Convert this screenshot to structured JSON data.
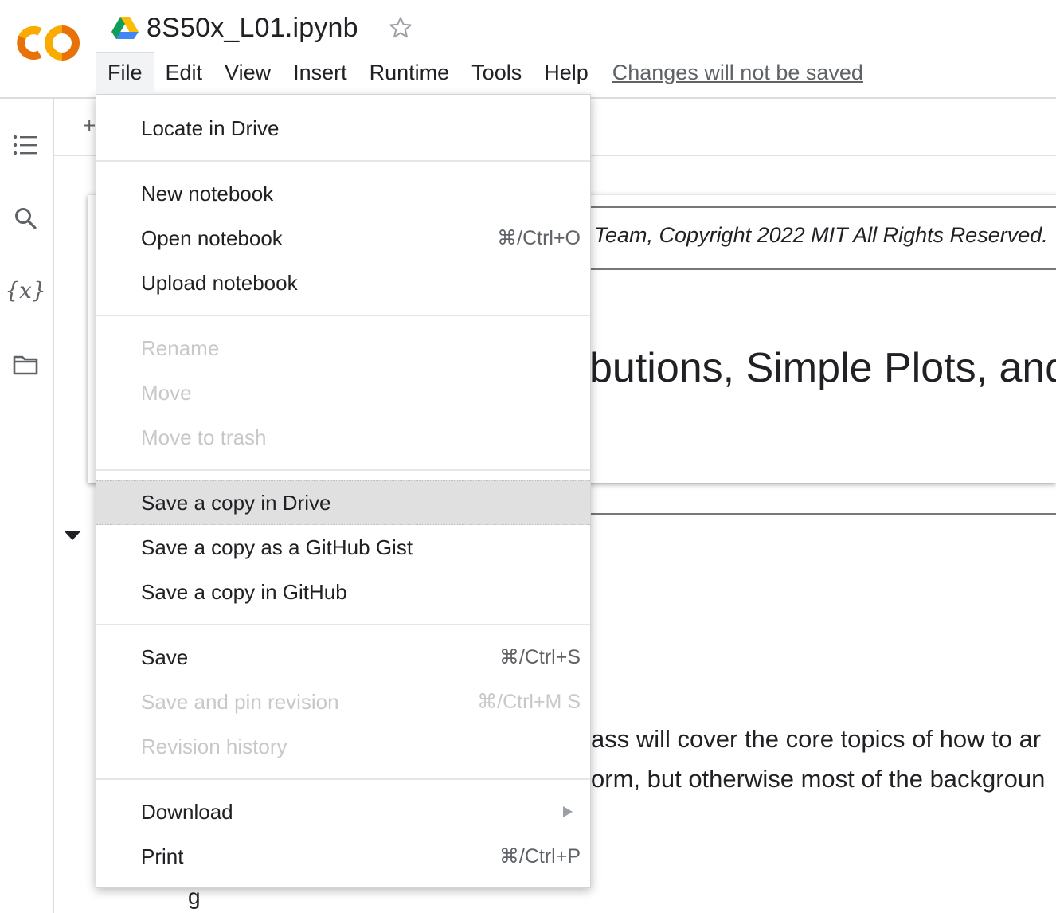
{
  "app": {
    "notebook_title": "8S50x_L01.ipynb",
    "colors": {
      "logo_orange": "#F9AB00",
      "logo_dark_orange": "#E8710A"
    }
  },
  "menubar": {
    "items": [
      "File",
      "Edit",
      "View",
      "Insert",
      "Runtime",
      "Tools",
      "Help"
    ],
    "active": "File",
    "changes_notice": "Changes will not be saved"
  },
  "rail": {
    "icons": [
      "table-of-contents-icon",
      "search-icon",
      "variables-icon",
      "files-folder-icon"
    ],
    "variables_glyph": "{x}"
  },
  "toolbar": {
    "add_glyph": "+"
  },
  "notebook": {
    "copyright_fragment": "Team, Copyright 2022 MIT All Rights Reserved.",
    "heading_fragment": "butions, Simple Plots, and",
    "body_line1": "ass will cover the core topics of how to ar",
    "body_line2": "orm, but otherwise most of the backgroun",
    "bottom_fragment": "g"
  },
  "file_menu": {
    "locate": "Locate in Drive",
    "new_notebook": "New notebook",
    "open_notebook": "Open notebook",
    "open_shortcut": "⌘/Ctrl+O",
    "upload_notebook": "Upload notebook",
    "rename": "Rename",
    "move": "Move",
    "move_to_trash": "Move to trash",
    "save_copy_drive": "Save a copy in Drive",
    "save_copy_gist": "Save a copy as a GitHub Gist",
    "save_copy_github": "Save a copy in GitHub",
    "save": "Save",
    "save_shortcut": "⌘/Ctrl+S",
    "save_pin": "Save and pin revision",
    "save_pin_shortcut": "⌘/Ctrl+M S",
    "revision_history": "Revision history",
    "download": "Download",
    "print": "Print",
    "print_shortcut": "⌘/Ctrl+P"
  }
}
